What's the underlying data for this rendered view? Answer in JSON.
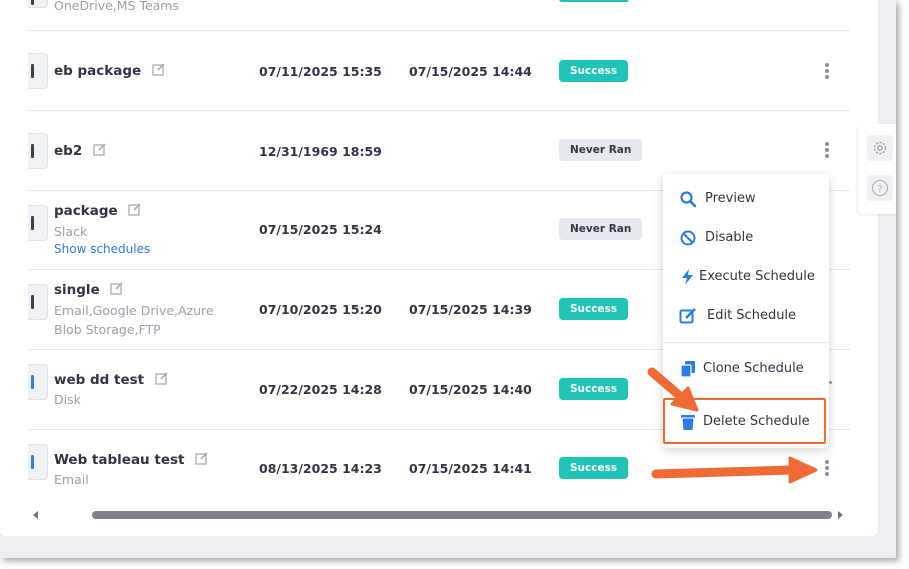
{
  "top_partial": {
    "text": "OneDrive,MS Teams"
  },
  "rows": [
    {
      "name": "eb package",
      "sub": "",
      "link": "",
      "created": "07/11/2025 15:35",
      "last_run": "07/15/2025 14:44",
      "status": "Success"
    },
    {
      "name": "eb2",
      "sub": "",
      "link": "",
      "created": "12/31/1969 18:59",
      "last_run": "",
      "status": "Never Ran"
    },
    {
      "name": "package",
      "sub": "Slack",
      "link": "Show schedules",
      "created": "07/15/2025 15:24",
      "last_run": "",
      "status": "Never Ran"
    },
    {
      "name": "single",
      "sub": "Email,Google Drive,Azure",
      "sub2": "Blob Storage,FTP",
      "link": "",
      "created": "07/10/2025 15:20",
      "last_run": "07/15/2025 14:39",
      "status": "Success"
    },
    {
      "name": "web dd test",
      "sub": "Disk",
      "link": "",
      "created": "07/22/2025 14:28",
      "last_run": "07/15/2025 14:40",
      "status": "Success"
    },
    {
      "name": "Web tableau test",
      "sub": "Email",
      "link": "",
      "created": "08/13/2025 14:23",
      "last_run": "07/15/2025 14:41",
      "status": "Success"
    }
  ],
  "context_menu": {
    "items": [
      {
        "label": "Preview",
        "icon": "search-icon"
      },
      {
        "label": "Disable",
        "icon": "ban-icon"
      },
      {
        "label": "Execute Schedule",
        "icon": "bolt-icon"
      },
      {
        "label": "Edit Schedule",
        "icon": "edit-icon"
      },
      {
        "label": "Clone Schedule",
        "icon": "copy-icon"
      },
      {
        "label": "Delete Schedule",
        "icon": "trash-icon"
      }
    ]
  },
  "colors": {
    "accent": "#2c7be5",
    "success": "#1fc4b6",
    "annotation": "#ef6a35"
  }
}
